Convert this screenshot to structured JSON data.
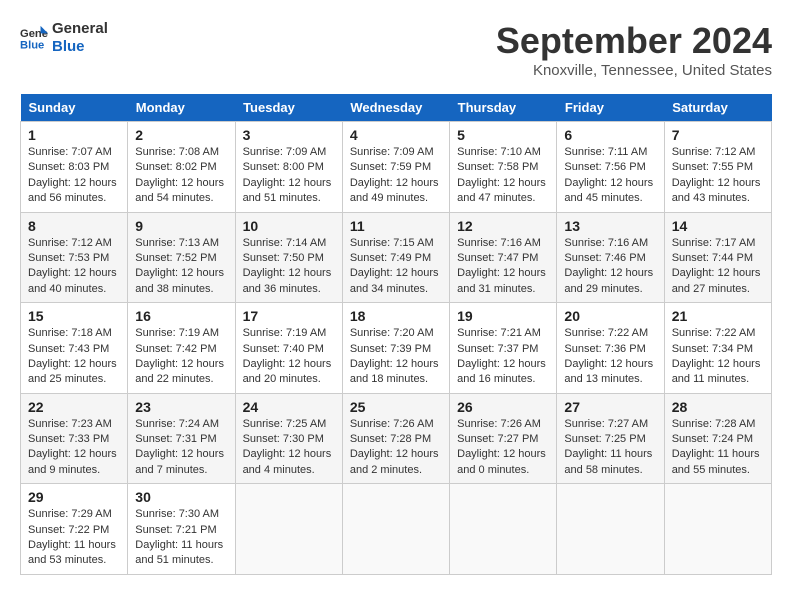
{
  "header": {
    "logo_line1": "General",
    "logo_line2": "Blue",
    "month_title": "September 2024",
    "location": "Knoxville, Tennessee, United States"
  },
  "calendar": {
    "days_of_week": [
      "Sunday",
      "Monday",
      "Tuesday",
      "Wednesday",
      "Thursday",
      "Friday",
      "Saturday"
    ],
    "weeks": [
      [
        {
          "day": "1",
          "info": "Sunrise: 7:07 AM\nSunset: 8:03 PM\nDaylight: 12 hours\nand 56 minutes."
        },
        {
          "day": "2",
          "info": "Sunrise: 7:08 AM\nSunset: 8:02 PM\nDaylight: 12 hours\nand 54 minutes."
        },
        {
          "day": "3",
          "info": "Sunrise: 7:09 AM\nSunset: 8:00 PM\nDaylight: 12 hours\nand 51 minutes."
        },
        {
          "day": "4",
          "info": "Sunrise: 7:09 AM\nSunset: 7:59 PM\nDaylight: 12 hours\nand 49 minutes."
        },
        {
          "day": "5",
          "info": "Sunrise: 7:10 AM\nSunset: 7:58 PM\nDaylight: 12 hours\nand 47 minutes."
        },
        {
          "day": "6",
          "info": "Sunrise: 7:11 AM\nSunset: 7:56 PM\nDaylight: 12 hours\nand 45 minutes."
        },
        {
          "day": "7",
          "info": "Sunrise: 7:12 AM\nSunset: 7:55 PM\nDaylight: 12 hours\nand 43 minutes."
        }
      ],
      [
        {
          "day": "8",
          "info": "Sunrise: 7:12 AM\nSunset: 7:53 PM\nDaylight: 12 hours\nand 40 minutes."
        },
        {
          "day": "9",
          "info": "Sunrise: 7:13 AM\nSunset: 7:52 PM\nDaylight: 12 hours\nand 38 minutes."
        },
        {
          "day": "10",
          "info": "Sunrise: 7:14 AM\nSunset: 7:50 PM\nDaylight: 12 hours\nand 36 minutes."
        },
        {
          "day": "11",
          "info": "Sunrise: 7:15 AM\nSunset: 7:49 PM\nDaylight: 12 hours\nand 34 minutes."
        },
        {
          "day": "12",
          "info": "Sunrise: 7:16 AM\nSunset: 7:47 PM\nDaylight: 12 hours\nand 31 minutes."
        },
        {
          "day": "13",
          "info": "Sunrise: 7:16 AM\nSunset: 7:46 PM\nDaylight: 12 hours\nand 29 minutes."
        },
        {
          "day": "14",
          "info": "Sunrise: 7:17 AM\nSunset: 7:44 PM\nDaylight: 12 hours\nand 27 minutes."
        }
      ],
      [
        {
          "day": "15",
          "info": "Sunrise: 7:18 AM\nSunset: 7:43 PM\nDaylight: 12 hours\nand 25 minutes."
        },
        {
          "day": "16",
          "info": "Sunrise: 7:19 AM\nSunset: 7:42 PM\nDaylight: 12 hours\nand 22 minutes."
        },
        {
          "day": "17",
          "info": "Sunrise: 7:19 AM\nSunset: 7:40 PM\nDaylight: 12 hours\nand 20 minutes."
        },
        {
          "day": "18",
          "info": "Sunrise: 7:20 AM\nSunset: 7:39 PM\nDaylight: 12 hours\nand 18 minutes."
        },
        {
          "day": "19",
          "info": "Sunrise: 7:21 AM\nSunset: 7:37 PM\nDaylight: 12 hours\nand 16 minutes."
        },
        {
          "day": "20",
          "info": "Sunrise: 7:22 AM\nSunset: 7:36 PM\nDaylight: 12 hours\nand 13 minutes."
        },
        {
          "day": "21",
          "info": "Sunrise: 7:22 AM\nSunset: 7:34 PM\nDaylight: 12 hours\nand 11 minutes."
        }
      ],
      [
        {
          "day": "22",
          "info": "Sunrise: 7:23 AM\nSunset: 7:33 PM\nDaylight: 12 hours\nand 9 minutes."
        },
        {
          "day": "23",
          "info": "Sunrise: 7:24 AM\nSunset: 7:31 PM\nDaylight: 12 hours\nand 7 minutes."
        },
        {
          "day": "24",
          "info": "Sunrise: 7:25 AM\nSunset: 7:30 PM\nDaylight: 12 hours\nand 4 minutes."
        },
        {
          "day": "25",
          "info": "Sunrise: 7:26 AM\nSunset: 7:28 PM\nDaylight: 12 hours\nand 2 minutes."
        },
        {
          "day": "26",
          "info": "Sunrise: 7:26 AM\nSunset: 7:27 PM\nDaylight: 12 hours\nand 0 minutes."
        },
        {
          "day": "27",
          "info": "Sunrise: 7:27 AM\nSunset: 7:25 PM\nDaylight: 11 hours\nand 58 minutes."
        },
        {
          "day": "28",
          "info": "Sunrise: 7:28 AM\nSunset: 7:24 PM\nDaylight: 11 hours\nand 55 minutes."
        }
      ],
      [
        {
          "day": "29",
          "info": "Sunrise: 7:29 AM\nSunset: 7:22 PM\nDaylight: 11 hours\nand 53 minutes."
        },
        {
          "day": "30",
          "info": "Sunrise: 7:30 AM\nSunset: 7:21 PM\nDaylight: 11 hours\nand 51 minutes."
        },
        {
          "day": "",
          "info": ""
        },
        {
          "day": "",
          "info": ""
        },
        {
          "day": "",
          "info": ""
        },
        {
          "day": "",
          "info": ""
        },
        {
          "day": "",
          "info": ""
        }
      ]
    ]
  }
}
